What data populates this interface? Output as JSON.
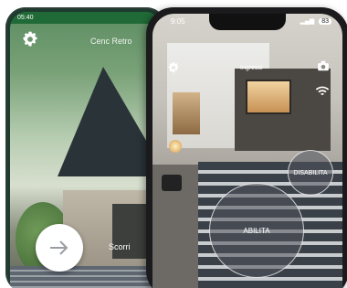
{
  "back_phone": {
    "status_time": "05:40",
    "title": "Cenc Retro",
    "swipe_label": "Scorri"
  },
  "front_phone": {
    "status_time": "9:05",
    "battery": "83",
    "location_label": "Ingressi",
    "disable_button": "DISABILITA",
    "enable_button": "ABILITA"
  },
  "icons": {
    "settings": "gear-icon",
    "arrow": "arrow-right-icon",
    "camera": "camera-icon",
    "wifi": "wifi-icon"
  },
  "colors": {
    "android_status_bar": "#1f6a36",
    "button_overlay": "#50545c"
  }
}
